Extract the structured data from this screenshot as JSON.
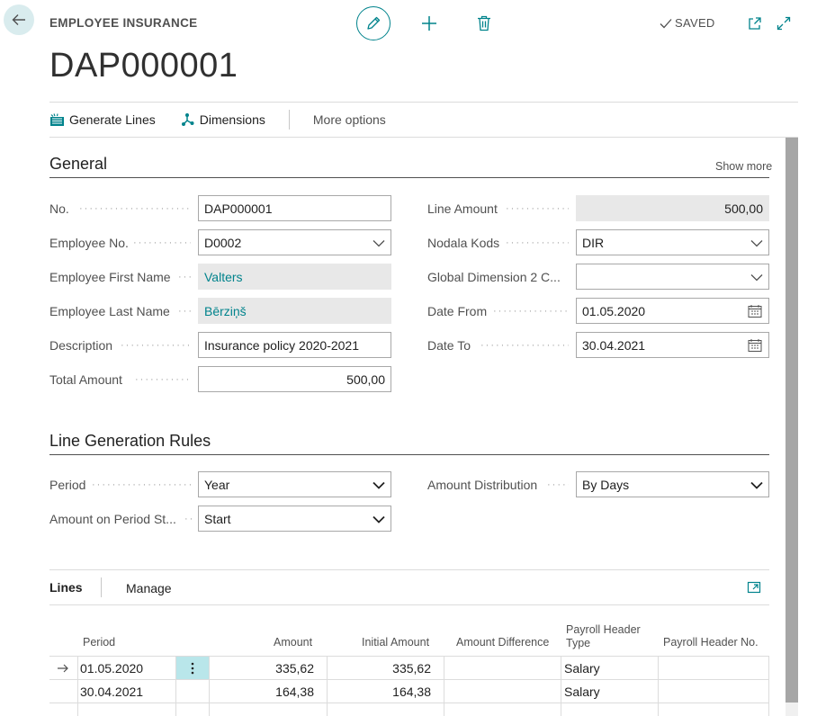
{
  "header": {
    "caption": "EMPLOYEE INSURANCE",
    "title": "DAP000001",
    "saved_label": "SAVED"
  },
  "actions": {
    "generate_lines": "Generate Lines",
    "dimensions": "Dimensions",
    "more_options": "More options"
  },
  "general": {
    "title": "General",
    "show_more": "Show more",
    "no_label": "No.",
    "no_value": "DAP000001",
    "employee_no_label": "Employee No.",
    "employee_no_value": "D0002",
    "first_name_label": "Employee First Name",
    "first_name_value": "Valters",
    "last_name_label": "Employee Last Name",
    "last_name_value": "Bērziņš",
    "description_label": "Description",
    "description_value": "Insurance policy 2020-2021",
    "total_amount_label": "Total Amount",
    "total_amount_value": "500,00",
    "line_amount_label": "Line Amount",
    "line_amount_value": "500,00",
    "nodala_label": "Nodala Kods",
    "nodala_value": "DIR",
    "global_dim2_label": "Global Dimension 2 C...",
    "global_dim2_value": "",
    "date_from_label": "Date From",
    "date_from_value": "01.05.2020",
    "date_to_label": "Date To",
    "date_to_value": "30.04.2021"
  },
  "rules": {
    "title": "Line Generation Rules",
    "period_label": "Period",
    "period_value": "Year",
    "amount_on_period_label": "Amount on Period St...",
    "amount_on_period_value": "Start",
    "amount_distribution_label": "Amount Distribution",
    "amount_distribution_value": "By Days"
  },
  "lines": {
    "title": "Lines",
    "manage": "Manage",
    "columns": {
      "period": "Period",
      "amount": "Amount",
      "initial_amount": "Initial Amount",
      "amount_difference": "Amount Difference",
      "payroll_header_type_1": "Payroll Header",
      "payroll_header_type_2": "Type",
      "payroll_header_no": "Payroll Header No."
    },
    "rows": [
      {
        "period": "01.05.2020",
        "amount": "335,62",
        "initial_amount": "335,62",
        "amount_difference": "",
        "payroll_header_type": "Salary",
        "payroll_header_no": ""
      },
      {
        "period": "30.04.2021",
        "amount": "164,38",
        "initial_amount": "164,38",
        "amount_difference": "",
        "payroll_header_type": "Salary",
        "payroll_header_no": ""
      }
    ]
  },
  "colors": {
    "accent": "#00838c",
    "selected_cell": "#b9e6ea",
    "readonly_field": "#e8e8e8"
  }
}
